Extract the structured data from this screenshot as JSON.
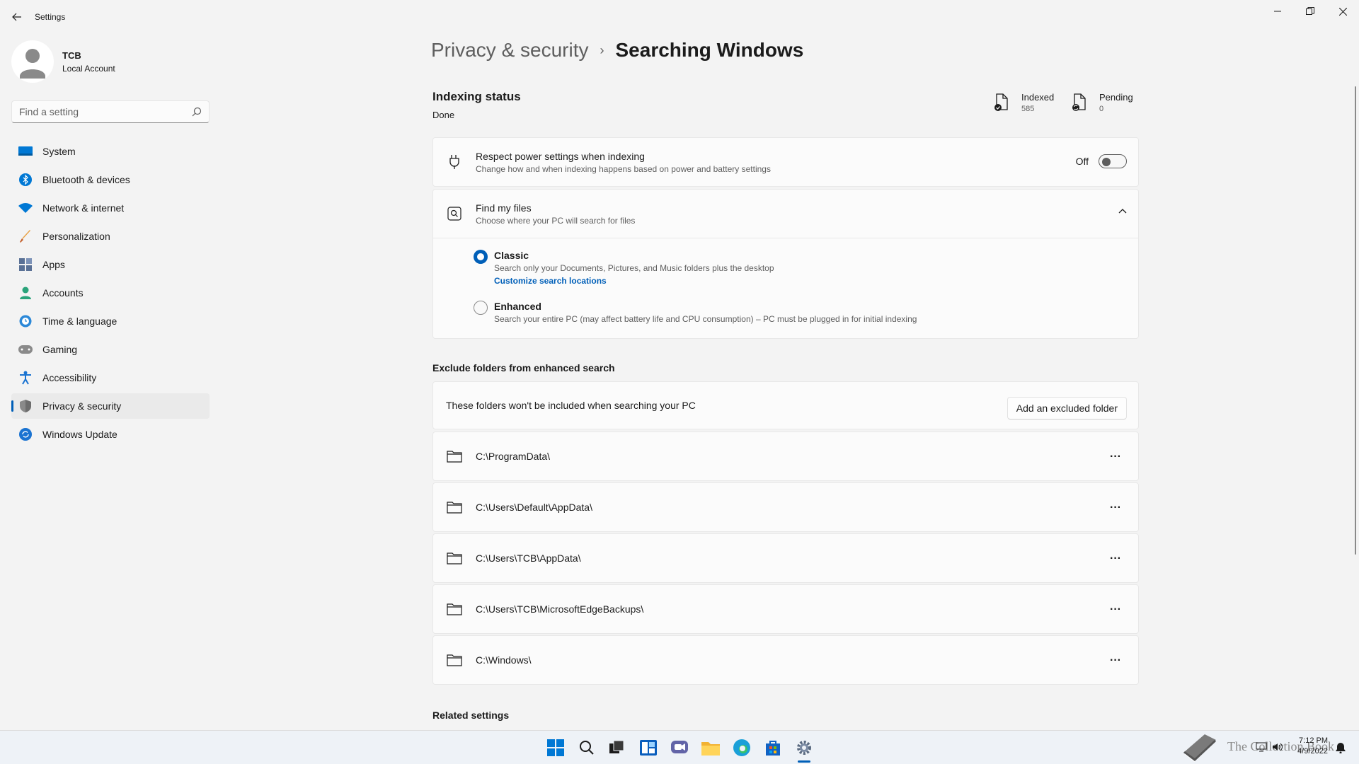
{
  "window": {
    "title": "Settings"
  },
  "profile": {
    "name": "TCB",
    "account_type": "Local Account"
  },
  "search": {
    "placeholder": "Find a setting"
  },
  "nav": [
    {
      "label": "System",
      "icon": "monitor-icon"
    },
    {
      "label": "Bluetooth & devices",
      "icon": "bluetooth-icon"
    },
    {
      "label": "Network & internet",
      "icon": "wifi-icon"
    },
    {
      "label": "Personalization",
      "icon": "brush-icon"
    },
    {
      "label": "Apps",
      "icon": "apps-icon"
    },
    {
      "label": "Accounts",
      "icon": "person-icon"
    },
    {
      "label": "Time & language",
      "icon": "globe-clock-icon"
    },
    {
      "label": "Gaming",
      "icon": "gamepad-icon"
    },
    {
      "label": "Accessibility",
      "icon": "accessibility-icon"
    },
    {
      "label": "Privacy & security",
      "icon": "shield-icon",
      "active": true
    },
    {
      "label": "Windows Update",
      "icon": "update-icon"
    }
  ],
  "breadcrumb": {
    "parent": "Privacy & security",
    "separator": "›",
    "current": "Searching Windows"
  },
  "indexing": {
    "title": "Indexing status",
    "status": "Done",
    "indexed_label": "Indexed",
    "indexed_value": "585",
    "pending_label": "Pending",
    "pending_value": "0"
  },
  "power": {
    "title": "Respect power settings when indexing",
    "subtitle": "Change how and when indexing happens based on power and battery settings",
    "state_label": "Off",
    "on": false
  },
  "find_files": {
    "title": "Find my files",
    "subtitle": "Choose where your PC will search for files",
    "classic": {
      "title": "Classic",
      "subtitle": "Search only your Documents, Pictures, and Music folders plus the desktop",
      "link": "Customize search locations",
      "selected": true
    },
    "enhanced": {
      "title": "Enhanced",
      "subtitle": "Search your entire PC (may affect battery life and CPU consumption) – PC must be plugged in for initial indexing",
      "selected": false
    }
  },
  "exclude": {
    "heading": "Exclude folders from enhanced search",
    "description": "These folders won't be included when searching your PC",
    "add_button": "Add an excluded folder",
    "folders": [
      "C:\\ProgramData\\",
      "C:\\Users\\Default\\AppData\\",
      "C:\\Users\\TCB\\AppData\\",
      "C:\\Users\\TCB\\MicrosoftEdgeBackups\\",
      "C:\\Windows\\"
    ],
    "more_label": "···"
  },
  "related": {
    "heading": "Related settings"
  },
  "taskbar": {
    "watermark": "The Collection Book",
    "time": "7:12 PM",
    "date": "4/9/2022",
    "accent": "#005fb8"
  }
}
